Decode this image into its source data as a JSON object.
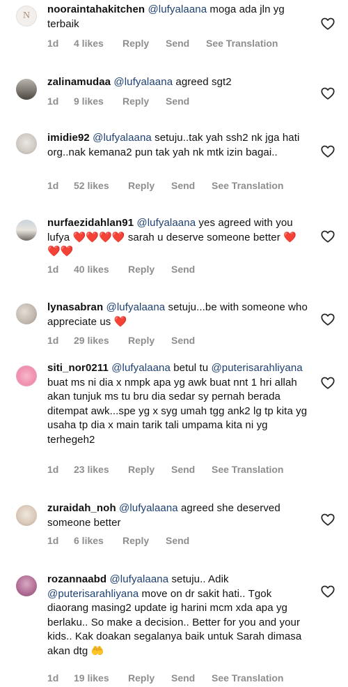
{
  "comments": [
    {
      "username": "noorainta­hakitchen",
      "mention": "@lufyalaana",
      "text": " moga ada jln yg terbaik",
      "time": "1d",
      "likes": "4 likes",
      "reply": "Reply",
      "send": "Send",
      "translate": "See Translation",
      "avatar_icon": "logo-n-avatar"
    },
    {
      "username": "zalinamudaa",
      "mention": "@lufyalaana",
      "text": " agreed sgt2",
      "time": "1d",
      "likes": "9 likes",
      "reply": "Reply",
      "send": "Send",
      "translate": "",
      "avatar_icon": "photo-avatar"
    },
    {
      "username": "imidie92",
      "mention": "@lufyalaana",
      "text": " setuju..tak yah ssh2 nk jga hati org..nak kemana2 pun tak yah nk mtk izin bagai..",
      "time": "1d",
      "likes": "52 likes",
      "reply": "Reply",
      "send": "Send",
      "translate": "See Translation",
      "avatar_icon": "photo-avatar"
    },
    {
      "username": "nurfaezidahlan91",
      "mention": "@lufyalaana",
      "text": " yes agreed with you lufya ",
      "emoji1": "❤️❤️❤️❤️",
      "text2": " sarah u deserve someone better ",
      "emoji2": "❤️❤️❤️",
      "time": "1d",
      "likes": "40 likes",
      "reply": "Reply",
      "send": "Send",
      "translate": "",
      "avatar_icon": "photo-avatar"
    },
    {
      "username": "lynasabran",
      "mention": "@lufyalaana",
      "text": " setuju...be with someone who appreciate us ",
      "emoji1": "❤️",
      "time": "1d",
      "likes": "29 likes",
      "reply": "Reply",
      "send": "Send",
      "translate": "",
      "avatar_icon": "photo-avatar"
    },
    {
      "username": "siti_nor0211",
      "mention": "@lufyalaana",
      "text": " betul tu ",
      "mention2": "@puterisarahliyana",
      "text2": " buat ms ni dia x nmpk apa yg awk buat nnt 1 hri allah akan tunjuk ms tu bru dia sedar sy pernah berada ditempat awk...spe yg x syg umah tgg ank2 lg tp kita yg usaha tp dia x main tarik tali umpama kita ni yg terhegeh2",
      "time": "1d",
      "likes": "23 likes",
      "reply": "Reply",
      "send": "Send",
      "translate": "See Translation",
      "avatar_icon": "photo-avatar"
    },
    {
      "username": "zuraidah_noh",
      "mention": "@lufyalaana",
      "text": " agreed she deserved someone better",
      "time": "1d",
      "likes": "6 likes",
      "reply": "Reply",
      "send": "Send",
      "translate": "",
      "avatar_icon": "photo-avatar"
    },
    {
      "username": "rozannaabd",
      "mention": "@lufyalaana",
      "text": " setuju.. Adik ",
      "mention2": "@puterisarahliyana",
      "text2": " move on dr sakit hati.. Tgok diaorang masing2 update ig harini mcm xda apa yg berlaku.. So make a decision.. Better for you and your kids.. Kak doakan segalanya baik untuk Sarah dimasa akan dtg ",
      "emoji1": "🤲",
      "time": "1d",
      "likes": "19 likes",
      "reply": "Reply",
      "send": "Send",
      "translate": "See Translation",
      "avatar_icon": "photo-avatar"
    }
  ],
  "colors": {
    "meta": "#8e8e8e",
    "mention": "#1d3f73",
    "heart": "#e3262a"
  },
  "icons": {
    "like": "heart-outline-icon"
  }
}
